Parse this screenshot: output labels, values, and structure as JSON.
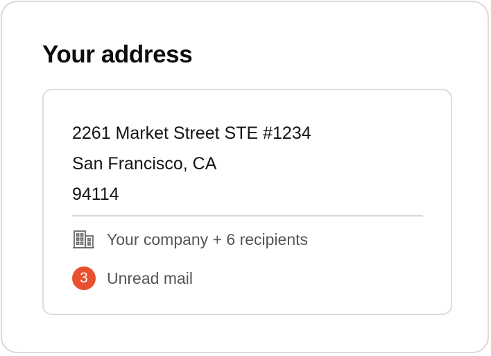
{
  "card": {
    "title": "Your address"
  },
  "address": {
    "line1": "2261 Market Street STE #1234",
    "line2": "San Francisco, CA",
    "line3": "94114"
  },
  "recipients": {
    "icon": "building-icon",
    "text": "Your company + 6 recipients"
  },
  "unread": {
    "count": "3",
    "text": "Unread mail",
    "badge_color": "#e8502f"
  }
}
